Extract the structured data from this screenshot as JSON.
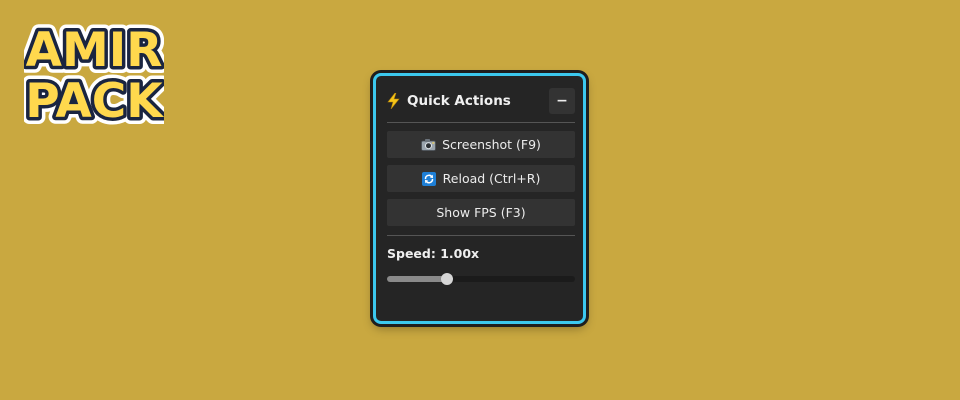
{
  "logo": {
    "line1": "AMIR",
    "line2": "PACK",
    "fill_color": "#ffd84d",
    "outline_color": "#1a2540"
  },
  "panel": {
    "title": "Quick Actions",
    "title_icon": "lightning-bolt-icon",
    "collapse_label": "−",
    "accent_border": "#3cc8ee",
    "actions": [
      {
        "label": "Screenshot (F9)",
        "icon": "camera-icon"
      },
      {
        "label": "Reload (Ctrl+R)",
        "icon": "refresh-icon"
      },
      {
        "label": "Show FPS (F3)",
        "icon": ""
      }
    ],
    "speed": {
      "label": "Speed: 1.00x",
      "value": 1.0,
      "slider_fraction": 0.32
    }
  }
}
